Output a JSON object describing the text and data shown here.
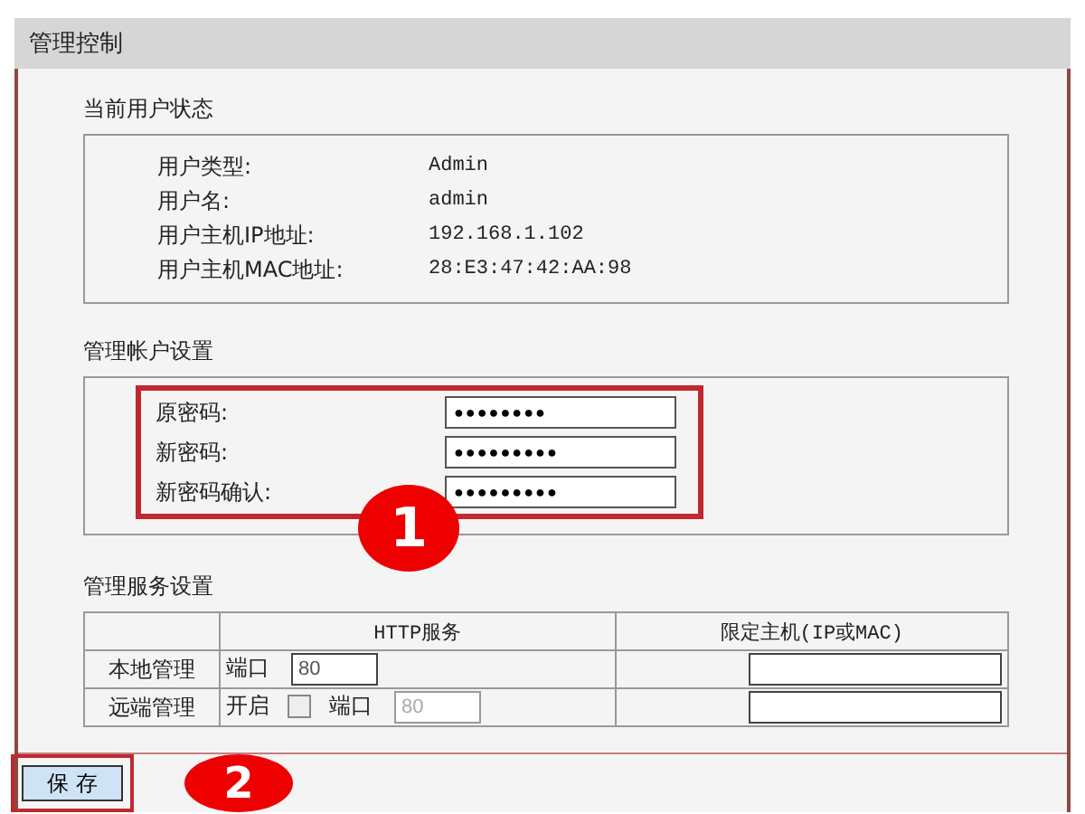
{
  "window": {
    "title": "管理控制"
  },
  "status": {
    "title": "当前用户状态",
    "rows": [
      {
        "label": "用户类型:",
        "value": "Admin"
      },
      {
        "label": "用户名:",
        "value": "admin"
      },
      {
        "label": "用户主机IP地址:",
        "value": "192.168.1.102"
      },
      {
        "label": "用户主机MAC地址:",
        "value": "28:E3:47:42:AA:98"
      }
    ]
  },
  "account": {
    "title": "管理帐户设置",
    "highlighted": true,
    "marker": "1",
    "fields": [
      {
        "label": "原密码:",
        "value": "●●●●●●●●"
      },
      {
        "label": "新密码:",
        "value": "●●●●●●●●●"
      },
      {
        "label": "新密码确认:",
        "value": "●●●●●●●●●"
      }
    ]
  },
  "service": {
    "title": "管理服务设置",
    "columns": [
      "HTTP服务",
      "限定主机(IP或MAC)"
    ],
    "rows": [
      {
        "name": "本地管理",
        "enable_label": null,
        "enabled": null,
        "port_label": "端口",
        "port": "80",
        "port_disabled": false
      },
      {
        "name": "远端管理",
        "enable_label": "开启",
        "enabled": false,
        "port_label": "端口",
        "port": "80",
        "port_disabled": true
      }
    ]
  },
  "save": {
    "label": "保 存",
    "highlighted": true,
    "marker": "2"
  }
}
